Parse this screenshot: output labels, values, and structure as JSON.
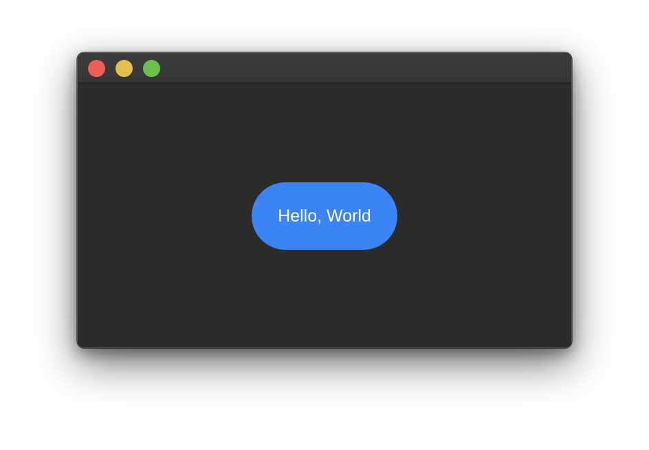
{
  "window": {
    "traffic_lights": [
      {
        "name": "close",
        "color": "#ec5f57"
      },
      {
        "name": "minimize",
        "color": "#e3c04b"
      },
      {
        "name": "zoom",
        "color": "#6cc04a"
      }
    ]
  },
  "main": {
    "button_label": "Hello, World",
    "button_color": "#3a84f5"
  }
}
